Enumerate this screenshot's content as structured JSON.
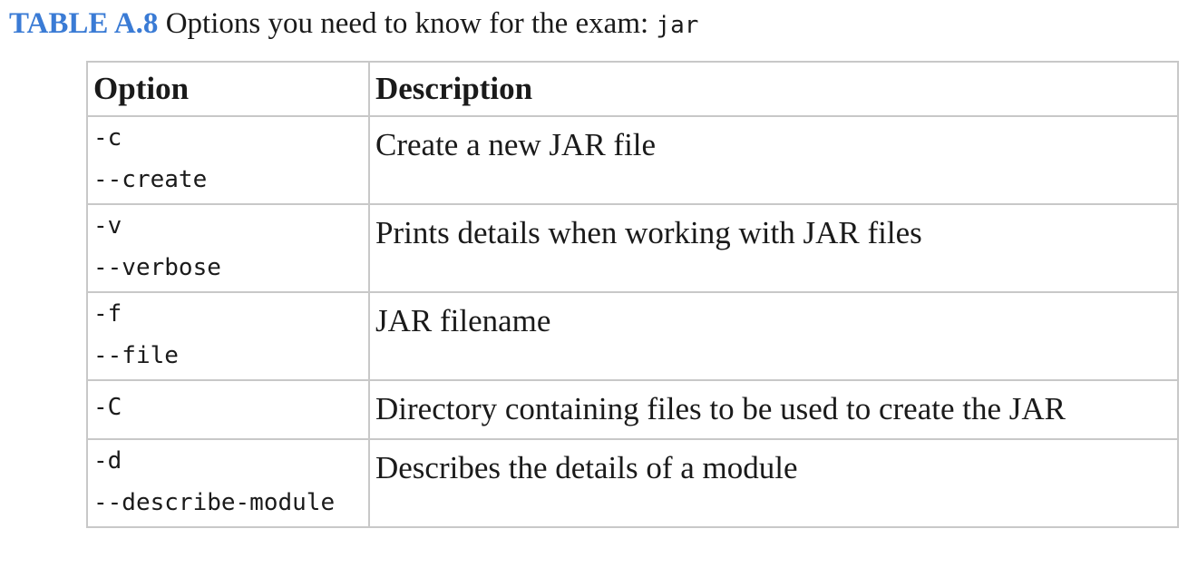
{
  "caption": {
    "label": "TABLE A.8",
    "text": " Options you need to know for the exam: ",
    "code": "jar"
  },
  "table": {
    "headers": [
      "Option",
      "Description"
    ],
    "rows": [
      {
        "short": "-c",
        "long": "--create",
        "description": "Create a new JAR file"
      },
      {
        "short": "-v",
        "long": "--verbose",
        "description": "Prints details when working with JAR files"
      },
      {
        "short": "-f",
        "long": "--file",
        "description": "JAR filename"
      },
      {
        "short": "-C",
        "long": "",
        "description": "Directory containing files to be used to create the JAR"
      },
      {
        "short": "-d",
        "long": "--describe-module",
        "description": "Describes the details of a module"
      }
    ]
  }
}
